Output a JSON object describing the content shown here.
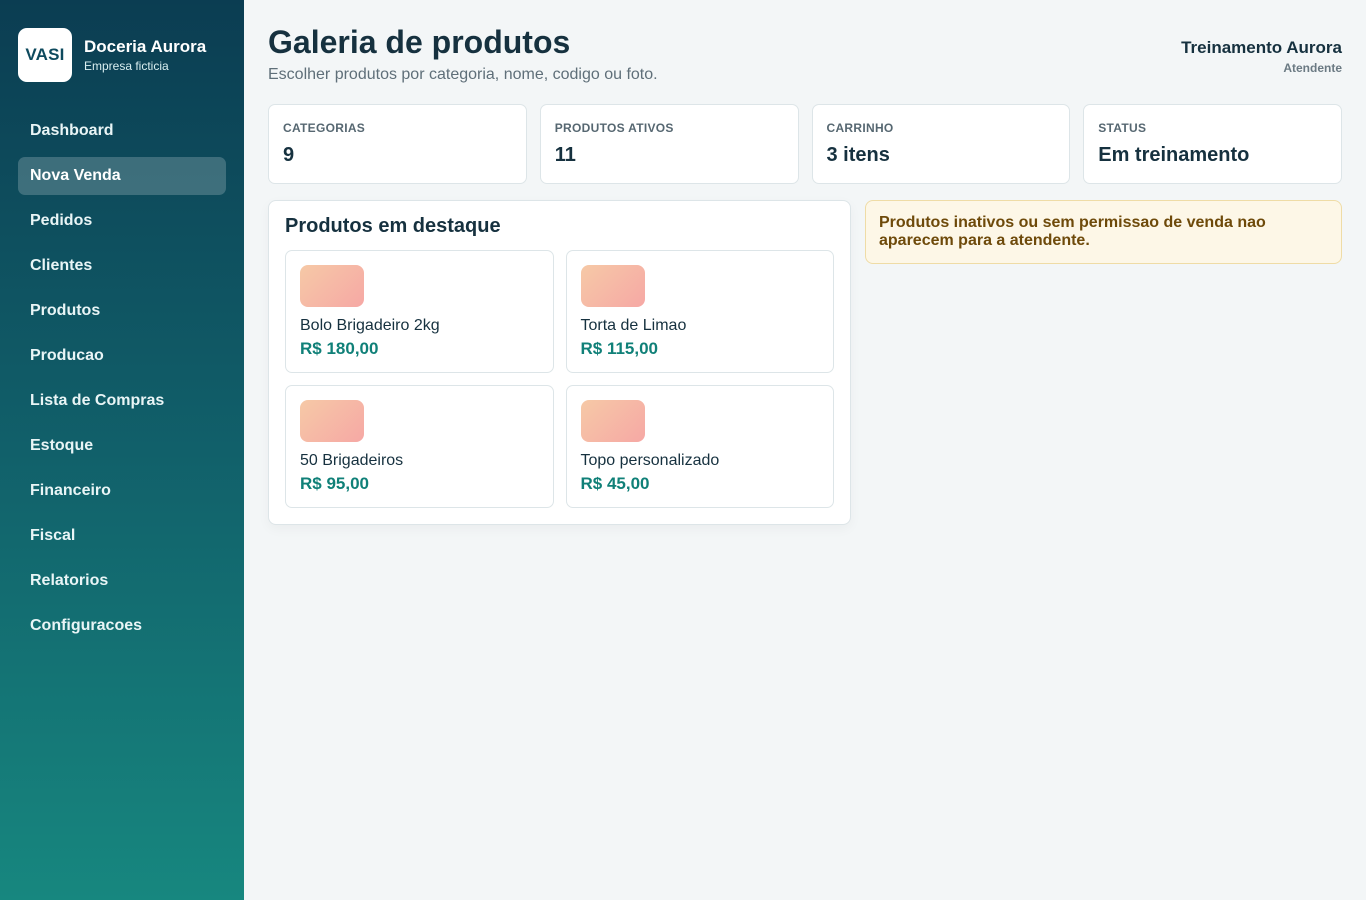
{
  "brand": {
    "logo": "VASI",
    "name": "Doceria Aurora",
    "subtitle": "Empresa ficticia"
  },
  "sidebar": {
    "items": [
      {
        "label": "Dashboard"
      },
      {
        "label": "Nova Venda",
        "active": true
      },
      {
        "label": "Pedidos"
      },
      {
        "label": "Clientes"
      },
      {
        "label": "Produtos"
      },
      {
        "label": "Producao"
      },
      {
        "label": "Lista de Compras"
      },
      {
        "label": "Estoque"
      },
      {
        "label": "Financeiro"
      },
      {
        "label": "Fiscal"
      },
      {
        "label": "Relatorios"
      },
      {
        "label": "Configuracoes"
      }
    ]
  },
  "header": {
    "title": "Galeria de produtos",
    "subtitle": "Escolher produtos por categoria, nome, codigo ou foto.",
    "user_name": "Treinamento Aurora",
    "user_role": "Atendente"
  },
  "stats": [
    {
      "label": "CATEGORIAS",
      "value": "9"
    },
    {
      "label": "PRODUTOS ATIVOS",
      "value": "11"
    },
    {
      "label": "CARRINHO",
      "value": "3 itens"
    },
    {
      "label": "STATUS",
      "value": "Em treinamento"
    }
  ],
  "featured": {
    "title": "Produtos em destaque",
    "products": [
      {
        "name": "Bolo Brigadeiro 2kg",
        "price": "R$ 180,00"
      },
      {
        "name": "Torta de Limao",
        "price": "R$ 115,00"
      },
      {
        "name": "50 Brigadeiros",
        "price": "R$ 95,00"
      },
      {
        "name": "Topo personalizado",
        "price": "R$ 45,00"
      }
    ]
  },
  "notice": {
    "text": "Produtos inativos ou sem permissao de venda nao aparecem para a atendente."
  },
  "colors": {
    "accent": "#108078",
    "sidebar_top": "#0b3d52",
    "sidebar_bottom": "#17877f",
    "notice_bg": "#fdf7e7"
  }
}
